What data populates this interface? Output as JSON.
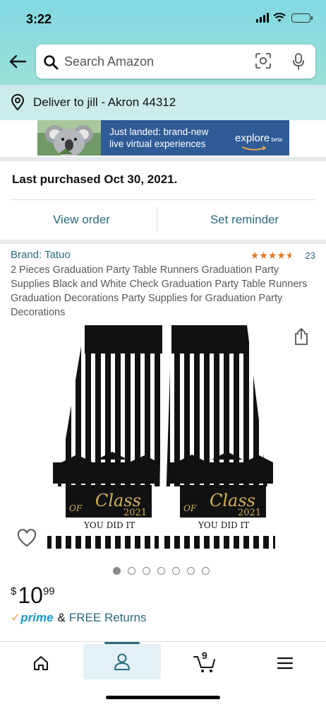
{
  "status_bar": {
    "time": "3:22"
  },
  "header": {
    "search": {
      "placeholder": "Search Amazon",
      "value": ""
    }
  },
  "delivery": {
    "text": "Deliver to jill - Akron 44312"
  },
  "banner": {
    "line1": "Just landed: brand-new",
    "line2": "live virtual experiences",
    "logo": "explore",
    "logo_suffix": "beta"
  },
  "order": {
    "last_purchased": "Last purchased Oct 30, 2021.",
    "view_order_label": "View order",
    "set_reminder_label": "Set reminder"
  },
  "product": {
    "brand": "Brand: Tatuo",
    "rating_stars": 4.5,
    "rating_count": "23",
    "title": "2 Pieces Graduation Party Table Runners Graduation Party Supplies Black and White Check Graduation Party Table Runners Graduation Decorations Party Supplies for Graduation Party Decorations",
    "image_text": {
      "class_of": "Class",
      "of": "OF",
      "year": "2021",
      "tagline": "YOU DID IT"
    },
    "carousel": {
      "count": 7,
      "active": 0
    },
    "price": {
      "currency": "$",
      "whole": "10",
      "fraction": "99"
    },
    "prime": {
      "word": "prime",
      "amp": "&",
      "free_returns": "FREE Returns"
    }
  },
  "bottom_nav": {
    "items": [
      "home",
      "you",
      "cart",
      "menu"
    ],
    "active": "you",
    "cart_count": "9"
  },
  "colors": {
    "link": "#2b6a7c",
    "star": "#de7921",
    "prime": "#1399c6",
    "header_gradient_top": "#82d8e3",
    "header_gradient_bottom": "#a6e4d2"
  }
}
